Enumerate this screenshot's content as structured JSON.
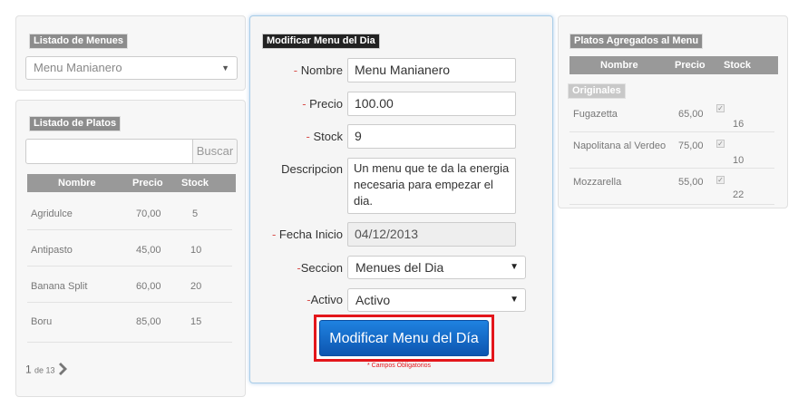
{
  "menus_panel": {
    "title": "Listado de Menues",
    "selected": "Menu Manianero"
  },
  "platos_panel": {
    "title": "Listado de Platos",
    "search_placeholder": "",
    "search_button": "Buscar",
    "columns": [
      "Nombre",
      "Precio",
      "Stock"
    ],
    "rows": [
      {
        "nombre": "Agridulce",
        "precio": "70,00",
        "stock": "5"
      },
      {
        "nombre": "Antipasto",
        "precio": "45,00",
        "stock": "10"
      },
      {
        "nombre": "Banana Split",
        "precio": "60,00",
        "stock": "20"
      },
      {
        "nombre": "Boru",
        "precio": "85,00",
        "stock": "15"
      }
    ],
    "pagination": {
      "current": "1",
      "of_label": "de 13",
      "next_icon": "chevron-right"
    }
  },
  "form": {
    "title": "Modificar Menu del Dia",
    "required_mark": "- ",
    "fields": {
      "nombre_label": "Nombre",
      "nombre_value": "Menu Manianero",
      "precio_label": "Precio",
      "precio_value": "100.00",
      "stock_label": "Stock",
      "stock_value": "9",
      "descripcion_label": "Descripcion",
      "descripcion_value": "Un menu que te da la energia necesaria para empezar el dia.",
      "fecha_label": "Fecha Inicio",
      "fecha_value": "04/12/2013",
      "seccion_label": "Seccion",
      "seccion_mark": "-",
      "seccion_value": "Menues del Dia",
      "activo_label": "Activo",
      "activo_mark": "-",
      "activo_value": "Activo"
    },
    "submit_label": "Modificar Menu del Día",
    "required_note": "* Campos Obligatorios"
  },
  "agregados_panel": {
    "title": "Platos Agregados al Menu",
    "columns": [
      "Nombre",
      "Precio",
      "Stock"
    ],
    "group_label": "Originales",
    "rows": [
      {
        "nombre": "Fugazetta",
        "precio": "65,00",
        "checked": true,
        "stock": "16"
      },
      {
        "nombre": "Napolitana al Verdeo",
        "precio": "75,00",
        "checked": true,
        "stock": "10"
      },
      {
        "nombre": "Mozzarella",
        "precio": "55,00",
        "checked": true,
        "stock": "22"
      }
    ]
  },
  "colors": {
    "accent_blue": "#1f82e0",
    "highlight_red": "#e3161b",
    "required_red": "#d9534f"
  }
}
